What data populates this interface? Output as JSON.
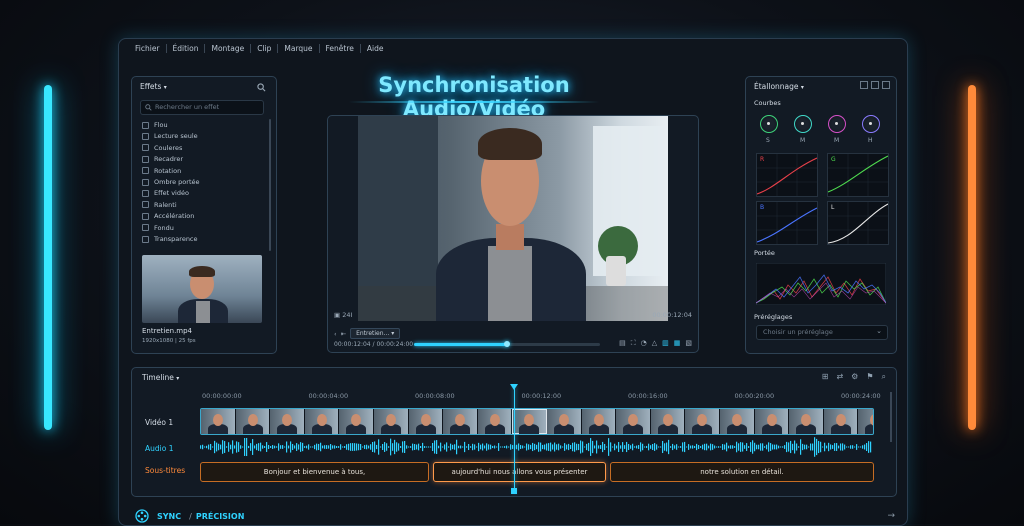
{
  "app": {
    "title": "Synchronisation Audio/Vidéo",
    "menu": [
      "Fichier",
      "Édition",
      "Montage",
      "Clip",
      "Marque",
      "Fenêtre",
      "Aide"
    ]
  },
  "effects": {
    "title": "Effets",
    "search_placeholder": "Rechercher un effet",
    "items": [
      "Flou",
      "Lecture seule",
      "Couleres",
      "Recadrer",
      "Rotation",
      "Ombre portée",
      "Effet vidéo",
      "Ralenti",
      "Accélération",
      "Fondu",
      "Transparence"
    ],
    "clip_name": "Entretien.mp4",
    "clip_meta": "1920x1080 | 25 fps"
  },
  "viewer": {
    "resolution": "24I",
    "timecode_right": "00:00:12:04",
    "clip_select": "Entretien...",
    "current_time": "00:00:12:04",
    "separator": "/",
    "duration": "00:00:24:00",
    "progress_percent": 50
  },
  "grading": {
    "title": "Étallonnage",
    "curves_label": "Courbes",
    "wheels": [
      {
        "label": "S",
        "color": "#3ed37a"
      },
      {
        "label": "M",
        "color": "#40d9c9"
      },
      {
        "label": "M",
        "color": "#d550c8"
      },
      {
        "label": "H",
        "color": "#8a7bff"
      }
    ],
    "curves": [
      {
        "label": "R",
        "color": "#e8404a"
      },
      {
        "label": "G",
        "color": "#4fdb4f"
      },
      {
        "label": "B",
        "color": "#4a74ff"
      },
      {
        "label": "L",
        "color": "#e8e8e8"
      }
    ],
    "scope_label": "Portée",
    "presets_label": "Préréglages",
    "preset_placeholder": "Choisir un préréglage"
  },
  "timeline": {
    "title": "Timeline",
    "ticks": [
      "00:00:00:00",
      "00:00:04:00",
      "00:00:08:00",
      "00:00:12:00",
      "00:00:16:00",
      "00:00:20:00",
      "00:00:24:00"
    ],
    "tracks": {
      "video": "Vidéo 1",
      "audio": "Audio 1",
      "subtitles": "Sous-titres"
    },
    "subtitles": [
      "Bonjour et bienvenue à tous,",
      "aujourd'hui nous allons vous présenter",
      "notre solution en détail."
    ]
  },
  "footer": {
    "sync": "SYNC",
    "slash": "/",
    "precision": "PRÉCISION"
  },
  "colors": {
    "accent": "#2fd2ff",
    "orange": "#ff8a3a"
  }
}
